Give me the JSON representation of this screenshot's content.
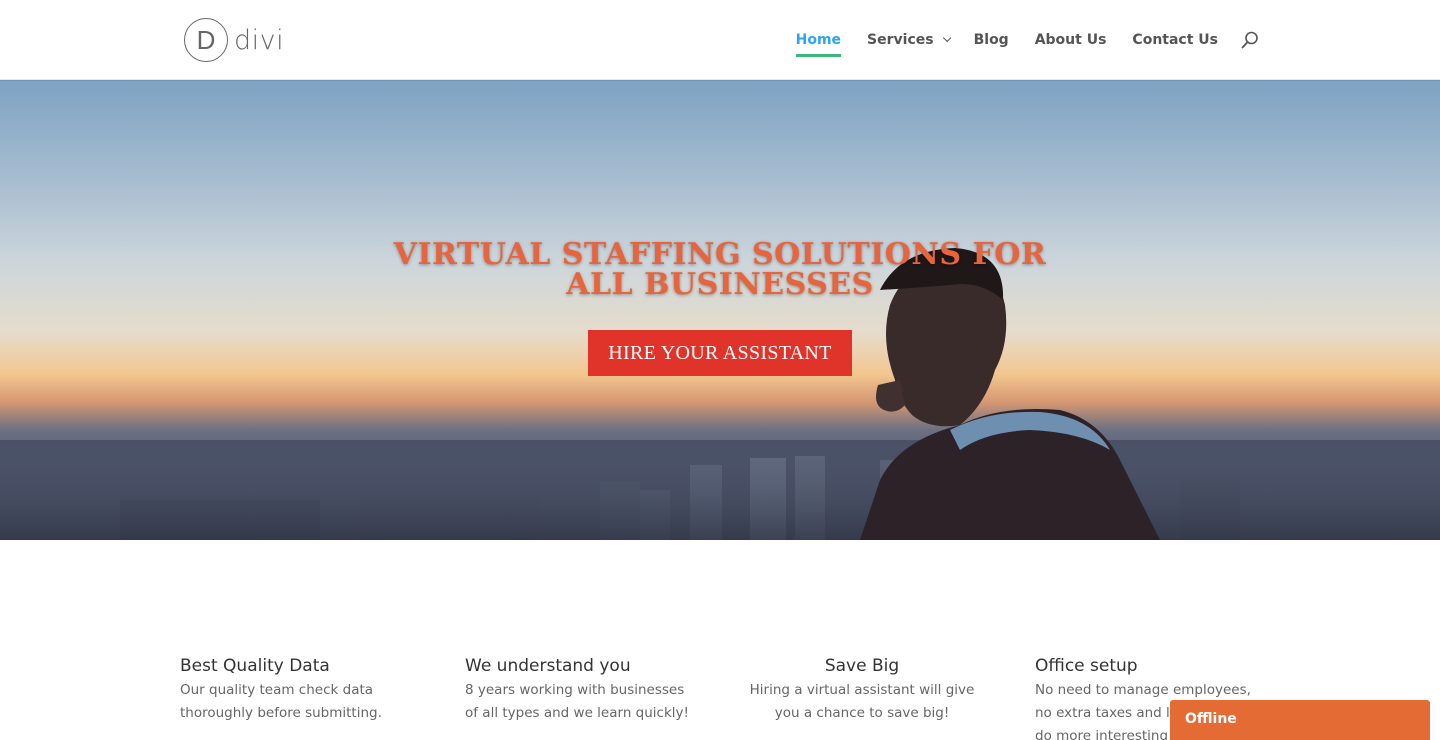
{
  "header": {
    "logo_letter": "D",
    "logo_text": "divi",
    "nav": [
      {
        "label": "Home",
        "active": true
      },
      {
        "label": "Services",
        "has_dropdown": true
      },
      {
        "label": "Blog"
      },
      {
        "label": "About Us"
      },
      {
        "label": "Contact Us"
      }
    ],
    "search_icon": "search-icon"
  },
  "hero": {
    "title": "VIRTUAL STAFFING SOLUTIONS FOR ALL BUSINESSES",
    "button_label": "HIRE YOUR ASSISTANT"
  },
  "features": [
    {
      "title": "Best Quality Data",
      "text": "Our quality team check data thoroughly before submitting."
    },
    {
      "title": "We understand you",
      "text": "8 years working with businesses of all types and we learn quickly!"
    },
    {
      "title": "Save Big",
      "text": "Hiring a virtual assistant will give you a chance to save big!"
    },
    {
      "title": "Office setup",
      "text": "No need to manage employees, no extra taxes and less worry, to do more interesting"
    }
  ],
  "chat": {
    "status_label": "Offline"
  },
  "colors": {
    "accent": "#2ea3f2",
    "nav_underline": "#3bb87a",
    "hero_title": "#e8643c",
    "button": "#e0342b",
    "chat": "#e56b34"
  }
}
